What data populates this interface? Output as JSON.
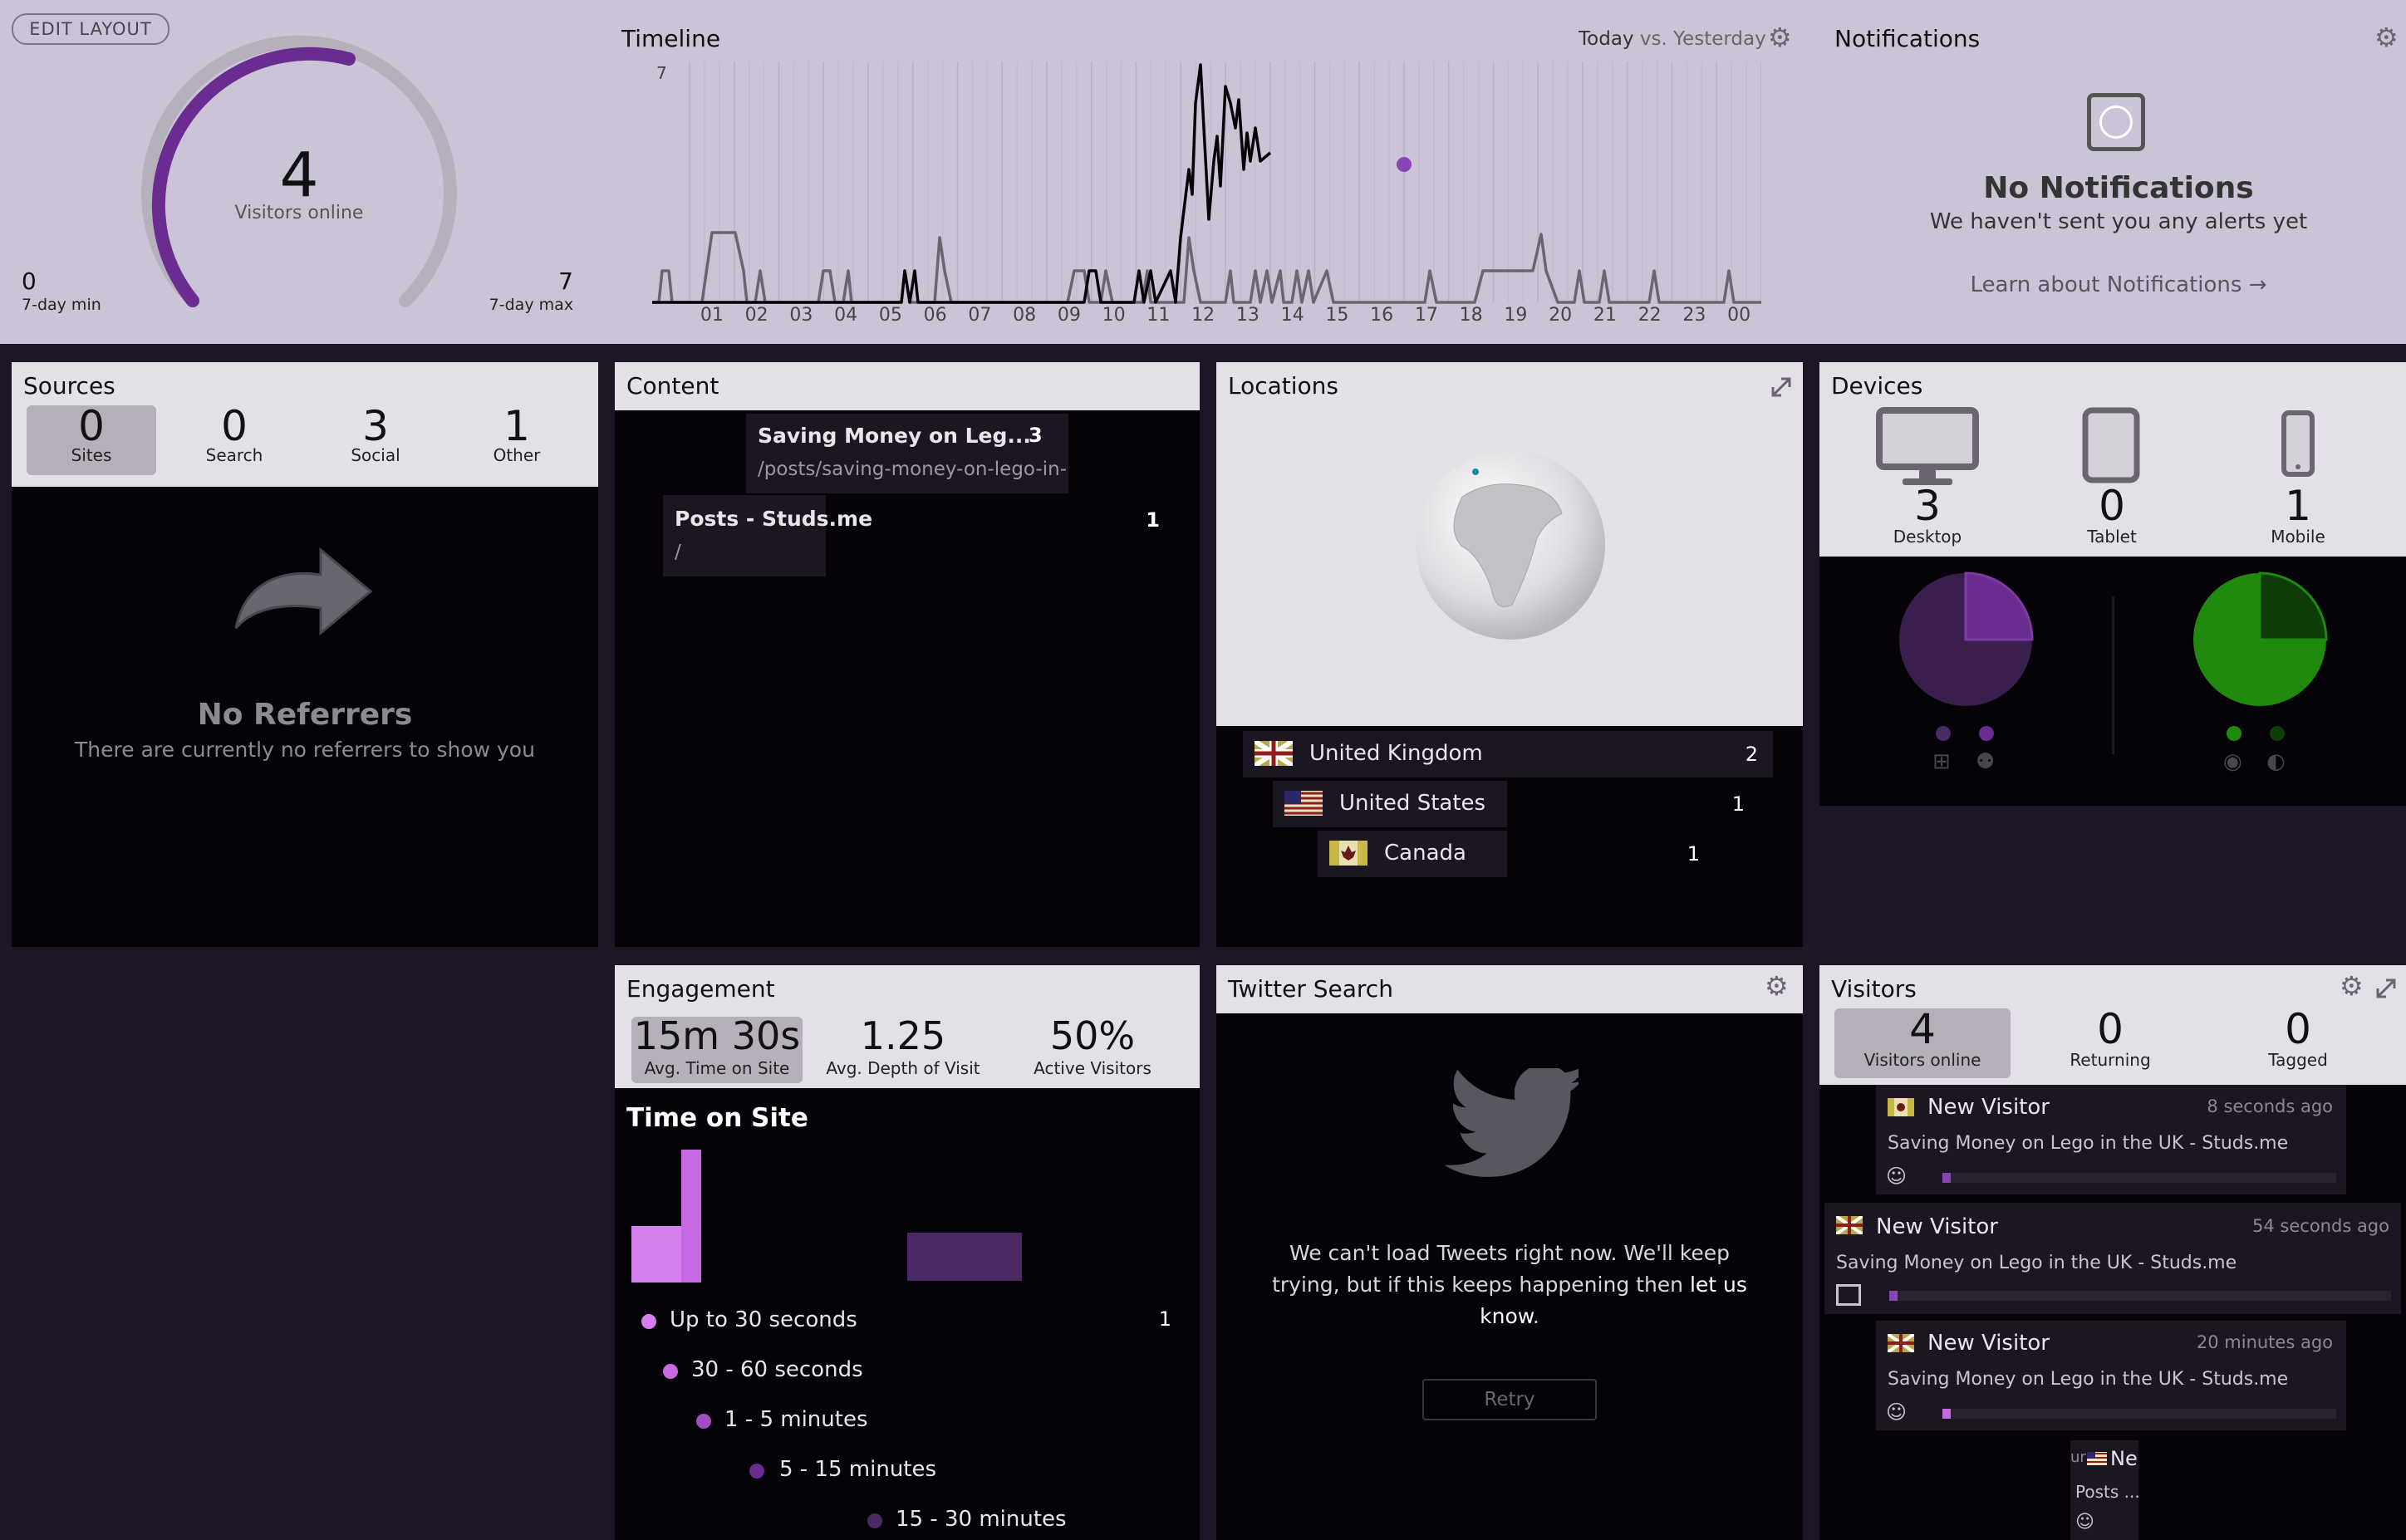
{
  "top": {
    "edit_layout": "EDIT LAYOUT",
    "visitors_online_count": "4",
    "visitors_online_label": "Visitors online",
    "min_value": "0",
    "min_label": "7-day min",
    "max_value": "7",
    "max_label": "7-day max"
  },
  "timeline": {
    "title": "Timeline",
    "compare_today": "Today",
    "compare_vs": "vs.",
    "compare_yesterday": "Yesterday",
    "y_max_label": "7",
    "hours": [
      "01",
      "02",
      "03",
      "04",
      "05",
      "06",
      "07",
      "08",
      "09",
      "10",
      "11",
      "12",
      "13",
      "14",
      "15",
      "16",
      "17",
      "18",
      "19",
      "20",
      "21",
      "22",
      "23",
      "00"
    ]
  },
  "notifications": {
    "title": "Notifications",
    "heading": "No Notifications",
    "subtext": "We haven't sent you any alerts yet",
    "link": "Learn about Notifications →"
  },
  "sources": {
    "title": "Sources",
    "stats": [
      {
        "value": "0",
        "label": "Sites"
      },
      {
        "value": "0",
        "label": "Search"
      },
      {
        "value": "3",
        "label": "Social"
      },
      {
        "value": "1",
        "label": "Other"
      }
    ],
    "empty_heading": "No Referrers",
    "empty_text": "There are currently no referrers to show you"
  },
  "content": {
    "title": "Content",
    "items": [
      {
        "title": "Saving Money on Leg...",
        "path": "/posts/saving-money-on-lego-in-tl",
        "count": "3"
      },
      {
        "title": "Posts - Studs.me",
        "path": "/",
        "count": "1"
      }
    ]
  },
  "locations": {
    "title": "Locations",
    "items": [
      {
        "country": "United Kingdom",
        "count": "2"
      },
      {
        "country": "United States",
        "count": "1"
      },
      {
        "country": "Canada",
        "count": "1"
      }
    ]
  },
  "devices": {
    "title": "Devices",
    "stats": [
      {
        "value": "3",
        "label": "Desktop"
      },
      {
        "value": "0",
        "label": "Tablet"
      },
      {
        "value": "1",
        "label": "Mobile"
      }
    ]
  },
  "engagement": {
    "title": "Engagement",
    "stats": [
      {
        "value": "15m 30s",
        "label": "Avg. Time on Site"
      },
      {
        "value": "1.25",
        "label": "Avg. Depth of Visit"
      },
      {
        "value": "50%",
        "label": "Active Visitors"
      }
    ],
    "chart_title": "Time on Site",
    "buckets": [
      {
        "label": "Up to 30 seconds",
        "count": "1"
      },
      {
        "label": "30 - 60 seconds",
        "count": ""
      },
      {
        "label": "1 - 5 minutes",
        "count": ""
      },
      {
        "label": "5 - 15 minutes",
        "count": ""
      },
      {
        "label": "15 - 30 minutes",
        "count": ""
      }
    ]
  },
  "twitter": {
    "title": "Twitter Search",
    "message_part1": "We can't load Tweets right now. We'll keep",
    "message_part2": "trying, but if this keeps happening then",
    "message_link1": "let us",
    "message_link2": "know",
    "message_end": ".",
    "retry": "Retry"
  },
  "visitors": {
    "title": "Visitors",
    "stats": [
      {
        "value": "4",
        "label": "Visitors online"
      },
      {
        "value": "0",
        "label": "Returning"
      },
      {
        "value": "0",
        "label": "Tagged"
      }
    ],
    "list": [
      {
        "name": "New Visitor",
        "time": "8 seconds ago",
        "page": "Saving Money on Lego in the UK - Studs.me"
      },
      {
        "name": "New Visitor",
        "time": "54 seconds ago",
        "page": "Saving Money on Lego in the UK - Studs.me"
      },
      {
        "name": "New Visitor",
        "time": "20 minutes ago",
        "page": "Saving Money on Lego in the UK - Studs.me"
      },
      {
        "name": "Ne",
        "time": "",
        "page": "Posts ..."
      }
    ],
    "partial_prefix": "ur"
  },
  "colors": {
    "purple": "#6a2c91",
    "green": "#1f8a0e",
    "top_bg": "#cbc4d6"
  }
}
